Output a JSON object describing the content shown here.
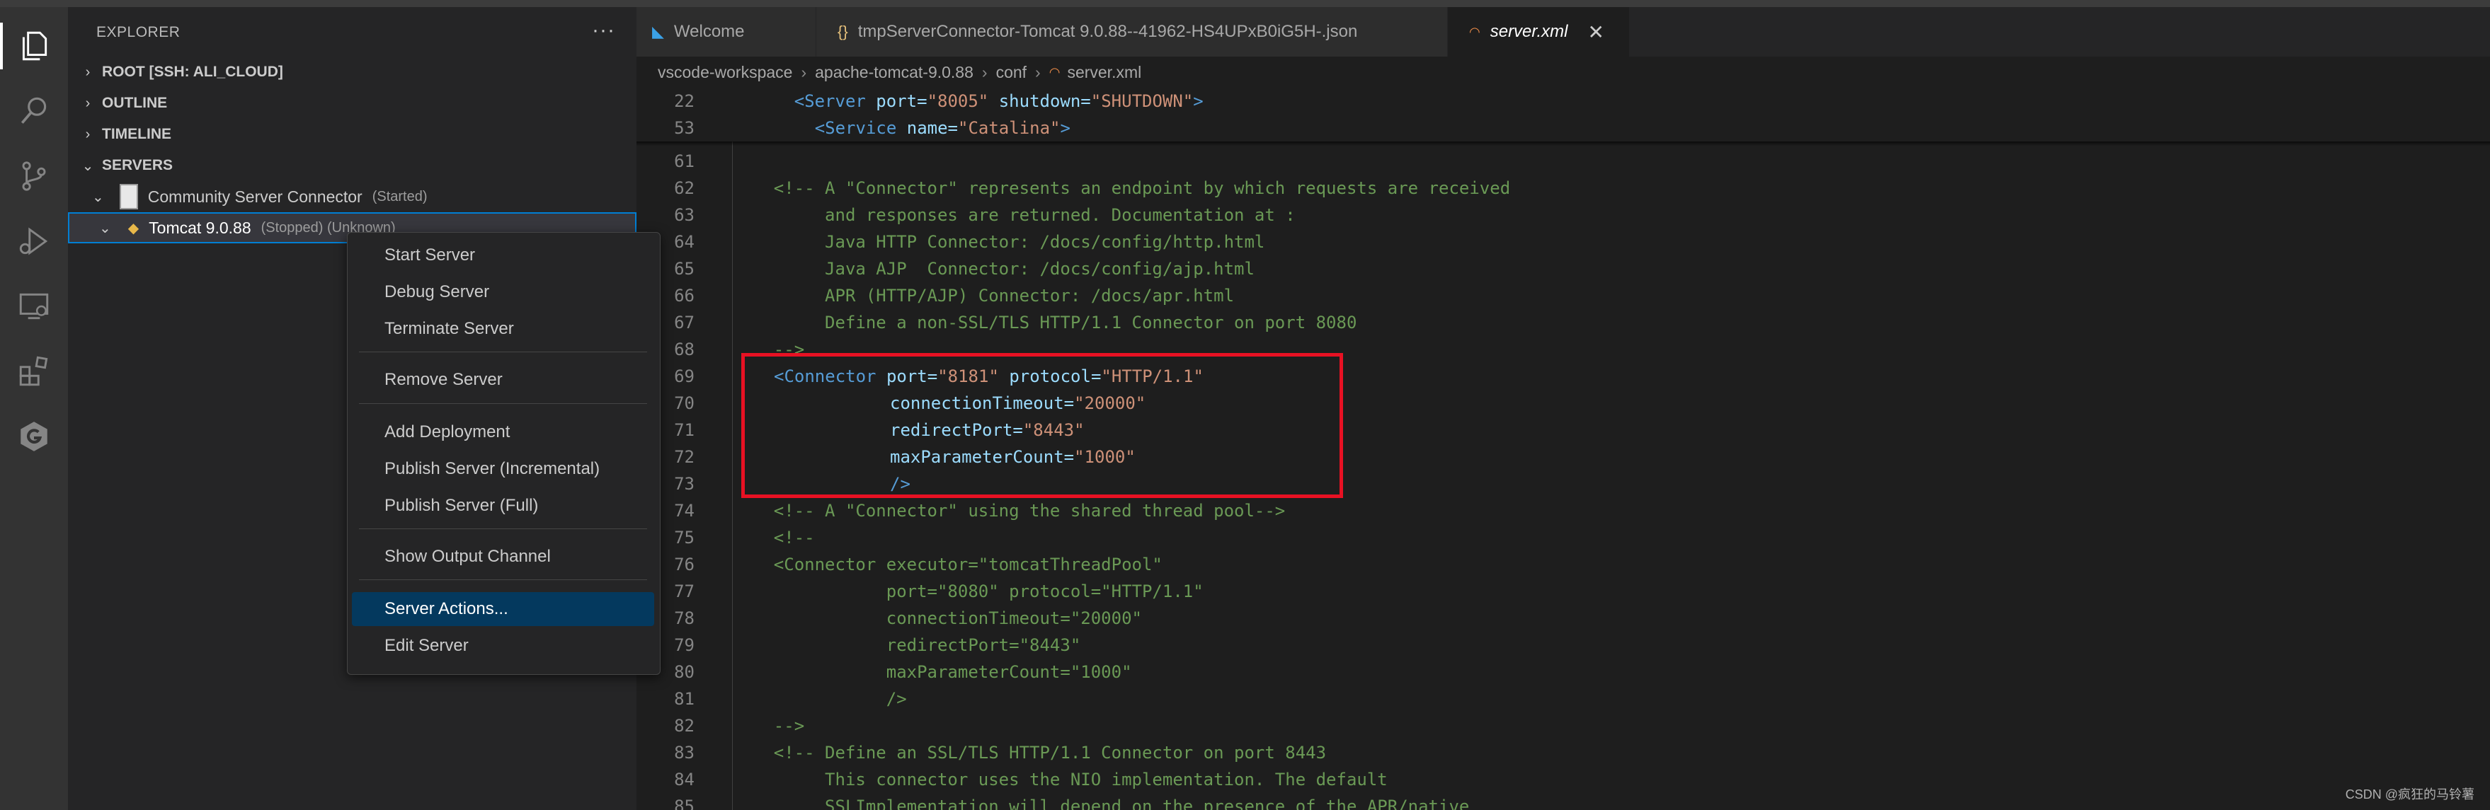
{
  "explorer": {
    "title": "EXPLORER",
    "more": "···",
    "sections": {
      "root": "ROOT [SSH: ALI_CLOUD]",
      "outline": "OUTLINE",
      "timeline": "TIMELINE",
      "servers": "SERVERS"
    },
    "server_connector": {
      "name": "Community Server Connector",
      "status": "(Started)"
    },
    "tomcat": {
      "name": "Tomcat 9.0.88",
      "status": "(Stopped) (Unknown)"
    }
  },
  "tabs": [
    {
      "label": "Welcome"
    },
    {
      "label": "tmpServerConnector-Tomcat 9.0.88--41962-HS4UPxB0iG5H-.json"
    },
    {
      "label": "server.xml"
    }
  ],
  "breadcrumb": [
    "vscode-workspace",
    "apache-tomcat-9.0.88",
    "conf",
    "server.xml"
  ],
  "context_menu": {
    "items": [
      "Start Server",
      "Debug Server",
      "Terminate Server",
      "Remove Server",
      "Add Deployment",
      "Publish Server (Incremental)",
      "Publish Server (Full)",
      "Show Output Channel",
      "Server Actions...",
      "Edit Server"
    ]
  },
  "editor": {
    "sticky": [
      {
        "ln": "22",
        "parts": [
          "<Server",
          " port=",
          "\"8005\"",
          " shutdown=",
          "\"SHUTDOWN\"",
          ">"
        ]
      },
      {
        "ln": "53",
        "parts": [
          "<Service",
          " name=",
          "\"Catalina\"",
          ">"
        ]
      }
    ],
    "lines": [
      {
        "ln": "61",
        "text": ""
      },
      {
        "ln": "62",
        "text": "    <!-- A \"Connector\" represents an endpoint by which requests are received"
      },
      {
        "ln": "63",
        "text": "         and responses are returned. Documentation at :"
      },
      {
        "ln": "64",
        "text": "         Java HTTP Connector: /docs/config/http.html"
      },
      {
        "ln": "65",
        "text": "         Java AJP  Connector: /docs/config/ajp.html"
      },
      {
        "ln": "66",
        "text": "         APR (HTTP/AJP) Connector: /docs/apr.html"
      },
      {
        "ln": "67",
        "text": "         Define a non-SSL/TLS HTTP/1.1 Connector on port 8080"
      },
      {
        "ln": "68",
        "text": "    -->"
      },
      {
        "ln": "69",
        "text": ""
      },
      {
        "ln": "70",
        "text": ""
      },
      {
        "ln": "71",
        "text": ""
      },
      {
        "ln": "72",
        "text": ""
      },
      {
        "ln": "73",
        "text": ""
      },
      {
        "ln": "74",
        "text": "    <!-- A \"Connector\" using the shared thread pool-->"
      },
      {
        "ln": "75",
        "text": "    <!--"
      },
      {
        "ln": "76",
        "text": "    <Connector executor=\"tomcatThreadPool\""
      },
      {
        "ln": "77",
        "text": "               port=\"8080\" protocol=\"HTTP/1.1\""
      },
      {
        "ln": "78",
        "text": "               connectionTimeout=\"20000\""
      },
      {
        "ln": "79",
        "text": "               redirectPort=\"8443\""
      },
      {
        "ln": "80",
        "text": "               maxParameterCount=\"1000\""
      },
      {
        "ln": "81",
        "text": "               />"
      },
      {
        "ln": "82",
        "text": "    -->"
      },
      {
        "ln": "83",
        "text": "    <!-- Define an SSL/TLS HTTP/1.1 Connector on port 8443"
      },
      {
        "ln": "84",
        "text": "         This connector uses the NIO implementation. The default"
      },
      {
        "ln": "85",
        "text": "         SSLImplementation will depend on the presence of the APR/native"
      }
    ],
    "connector": {
      "l69": [
        "<Connector",
        " port=",
        "\"8181\"",
        " protocol=",
        "\"HTTP/1.1\""
      ],
      "l70": [
        "connectionTimeout=",
        "\"20000\""
      ],
      "l71": [
        "redirectPort=",
        "\"8443\""
      ],
      "l72": [
        "maxParameterCount=",
        "\"1000\""
      ],
      "l73": "/>"
    }
  },
  "watermark": "CSDN @疯狂的马铃薯",
  "colors": {
    "accent": "#007fd4",
    "highlight_box": "#e81123",
    "menu_selected": "#04395e"
  }
}
